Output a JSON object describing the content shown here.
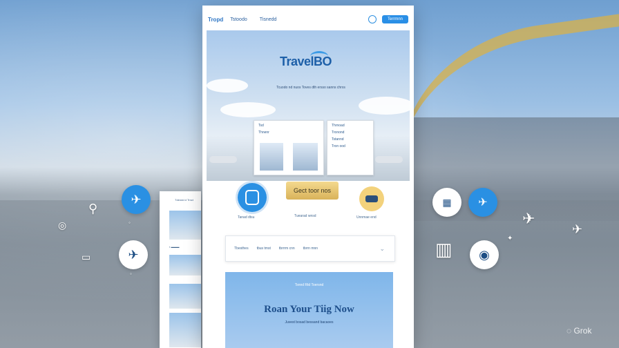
{
  "nav": {
    "logo": "Tropd",
    "link1": "Tstoodo",
    "link2": "Tisnedd",
    "button": "Terrmnn"
  },
  "hero": {
    "brand": "TravelBO",
    "subtitle": "Tcuodo nd nuos Toves dth ersso sanns chrxs"
  },
  "cards": [
    {
      "rows": [
        "Tsd",
        "Thnenr"
      ]
    },
    {
      "rows": [
        "Thrnoad",
        "Tronond",
        "Tstannd",
        "Tron ood"
      ]
    }
  ],
  "features": {
    "button": "Gect toor nos",
    "labels": [
      "Tanad dtsu",
      "Tuearad wnsd",
      "Unnmae end"
    ]
  },
  "search": {
    "fields": [
      "Tbesthes",
      "tbus tmst",
      "tbrrrm cnn",
      "tbrrn mnn"
    ]
  },
  "cta": {
    "top": "Tsnnd Rtd Toersnd",
    "title": "Roan Your Tiig Now",
    "subtitle": "Juvest bosad bessand bacaoes"
  },
  "side": {
    "header": "Tdendd d Trnct"
  },
  "watermark": "Grok"
}
